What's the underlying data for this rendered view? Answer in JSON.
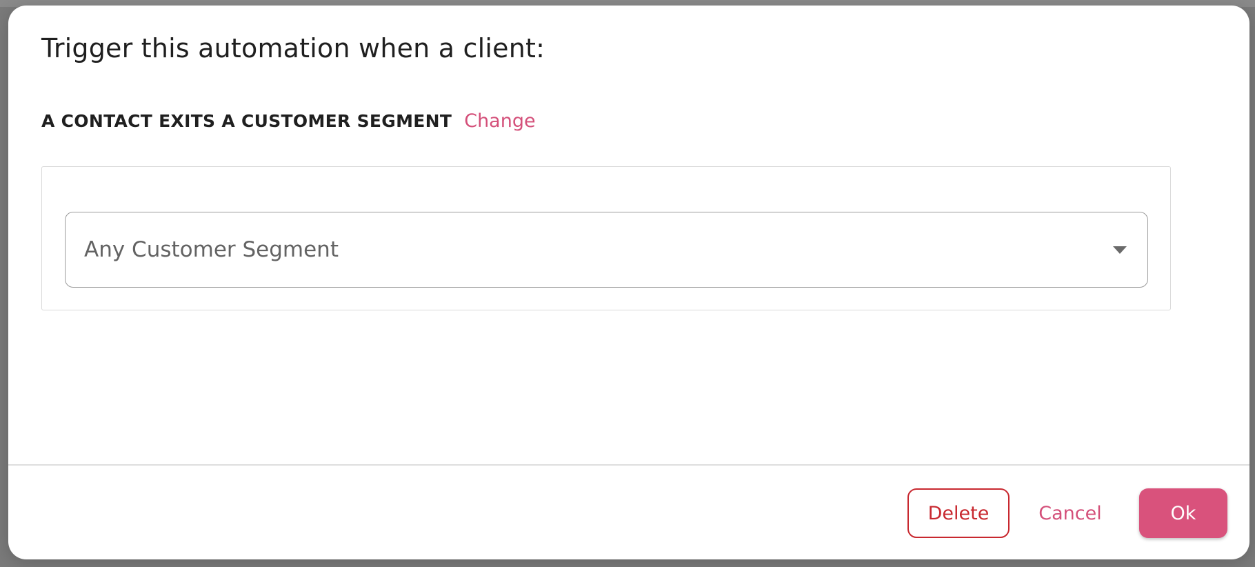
{
  "dialog": {
    "title": "Trigger this automation when a client:",
    "trigger_name": "A CONTACT EXITS A CUSTOMER SEGMENT",
    "change_label": "Change",
    "segment_select": {
      "selected_value": "Any Customer Segment"
    },
    "buttons": {
      "delete_label": "Delete",
      "cancel_label": "Cancel",
      "ok_label": "Ok"
    }
  },
  "colors": {
    "accent": "#d9527c",
    "link": "#d4507a",
    "danger": "#c8282f",
    "backdrop": "#7a7a7a"
  }
}
